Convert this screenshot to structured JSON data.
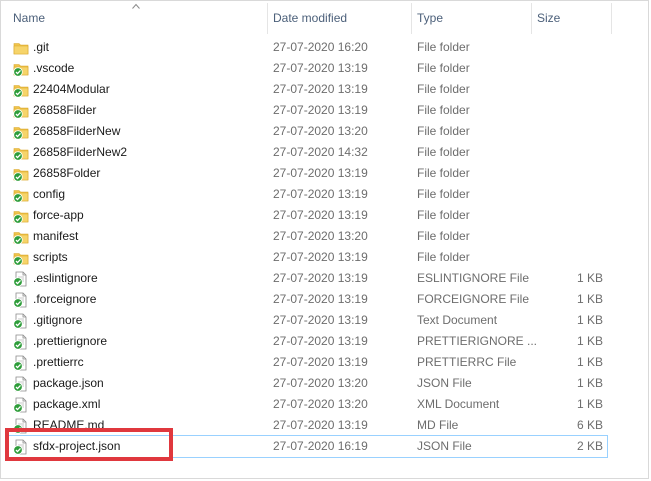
{
  "columns": {
    "name": "Name",
    "date": "Date modified",
    "type": "Type",
    "size": "Size"
  },
  "files": [
    {
      "name": ".git",
      "date": "27-07-2020 16:20",
      "type": "File folder",
      "size": "",
      "icon": "folder-icon"
    },
    {
      "name": ".vscode",
      "date": "27-07-2020 13:19",
      "type": "File folder",
      "size": "",
      "icon": "folder-synced-icon"
    },
    {
      "name": "22404Modular",
      "date": "27-07-2020 13:19",
      "type": "File folder",
      "size": "",
      "icon": "folder-synced-icon"
    },
    {
      "name": "26858Filder",
      "date": "27-07-2020 13:19",
      "type": "File folder",
      "size": "",
      "icon": "folder-synced-icon"
    },
    {
      "name": "26858FilderNew",
      "date": "27-07-2020 13:20",
      "type": "File folder",
      "size": "",
      "icon": "folder-synced-icon"
    },
    {
      "name": "26858FilderNew2",
      "date": "27-07-2020 14:32",
      "type": "File folder",
      "size": "",
      "icon": "folder-synced-icon"
    },
    {
      "name": "26858Folder",
      "date": "27-07-2020 13:19",
      "type": "File folder",
      "size": "",
      "icon": "folder-synced-icon"
    },
    {
      "name": "config",
      "date": "27-07-2020 13:19",
      "type": "File folder",
      "size": "",
      "icon": "folder-synced-icon"
    },
    {
      "name": "force-app",
      "date": "27-07-2020 13:19",
      "type": "File folder",
      "size": "",
      "icon": "folder-synced-icon"
    },
    {
      "name": "manifest",
      "date": "27-07-2020 13:20",
      "type": "File folder",
      "size": "",
      "icon": "folder-synced-icon"
    },
    {
      "name": "scripts",
      "date": "27-07-2020 13:19",
      "type": "File folder",
      "size": "",
      "icon": "folder-synced-icon"
    },
    {
      "name": ".eslintignore",
      "date": "27-07-2020 13:19",
      "type": "ESLINTIGNORE File",
      "size": "1 KB",
      "icon": "file-synced-icon"
    },
    {
      "name": ".forceignore",
      "date": "27-07-2020 13:19",
      "type": "FORCEIGNORE File",
      "size": "1 KB",
      "icon": "file-synced-icon"
    },
    {
      "name": ".gitignore",
      "date": "27-07-2020 13:19",
      "type": "Text Document",
      "size": "1 KB",
      "icon": "file-synced-icon"
    },
    {
      "name": ".prettierignore",
      "date": "27-07-2020 13:19",
      "type": "PRETTIERIGNORE ...",
      "size": "1 KB",
      "icon": "file-synced-icon"
    },
    {
      "name": ".prettierrc",
      "date": "27-07-2020 13:19",
      "type": "PRETTIERRC File",
      "size": "1 KB",
      "icon": "file-synced-icon"
    },
    {
      "name": "package.json",
      "date": "27-07-2020 13:20",
      "type": "JSON File",
      "size": "1 KB",
      "icon": "file-synced-icon"
    },
    {
      "name": "package.xml",
      "date": "27-07-2020 13:20",
      "type": "XML Document",
      "size": "1 KB",
      "icon": "file-synced-icon"
    },
    {
      "name": "README.md",
      "date": "27-07-2020 13:19",
      "type": "MD File",
      "size": "6 KB",
      "icon": "file-synced-icon"
    },
    {
      "name": "sfdx-project.json",
      "date": "27-07-2020 16:19",
      "type": "JSON File",
      "size": "2 KB",
      "icon": "file-synced-icon",
      "selected": true
    }
  ],
  "colors": {
    "folder": "#f0c44c",
    "sync_check": "#2e9d3a",
    "highlight": "#e0383e",
    "selection_outline": "#99d1ff"
  }
}
